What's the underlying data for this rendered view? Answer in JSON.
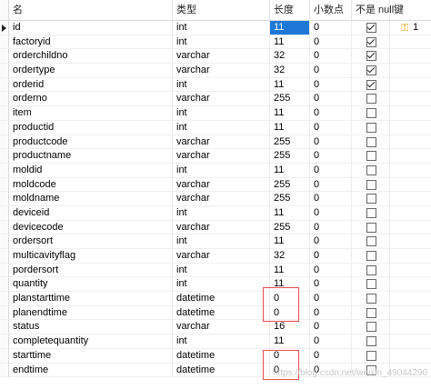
{
  "headers": {
    "name": "名",
    "type": "类型",
    "length": "长度",
    "decimals": "小数点",
    "not_null": "不是 null",
    "key": "键"
  },
  "rows": [
    {
      "name": "id",
      "type": "int",
      "length": "11",
      "decimals": "0",
      "not_null": true,
      "key": "1",
      "selected": true
    },
    {
      "name": "factoryid",
      "type": "int",
      "length": "11",
      "decimals": "0",
      "not_null": true,
      "key": ""
    },
    {
      "name": "orderchildno",
      "type": "varchar",
      "length": "32",
      "decimals": "0",
      "not_null": true,
      "key": ""
    },
    {
      "name": "ordertype",
      "type": "varchar",
      "length": "32",
      "decimals": "0",
      "not_null": true,
      "key": ""
    },
    {
      "name": "orderid",
      "type": "int",
      "length": "11",
      "decimals": "0",
      "not_null": true,
      "key": ""
    },
    {
      "name": "orderno",
      "type": "varchar",
      "length": "255",
      "decimals": "0",
      "not_null": false,
      "key": ""
    },
    {
      "name": "item",
      "type": "int",
      "length": "11",
      "decimals": "0",
      "not_null": false,
      "key": ""
    },
    {
      "name": "productid",
      "type": "int",
      "length": "11",
      "decimals": "0",
      "not_null": false,
      "key": ""
    },
    {
      "name": "productcode",
      "type": "varchar",
      "length": "255",
      "decimals": "0",
      "not_null": false,
      "key": ""
    },
    {
      "name": "productname",
      "type": "varchar",
      "length": "255",
      "decimals": "0",
      "not_null": false,
      "key": ""
    },
    {
      "name": "moldid",
      "type": "int",
      "length": "11",
      "decimals": "0",
      "not_null": false,
      "key": ""
    },
    {
      "name": "moldcode",
      "type": "varchar",
      "length": "255",
      "decimals": "0",
      "not_null": false,
      "key": ""
    },
    {
      "name": "moldname",
      "type": "varchar",
      "length": "255",
      "decimals": "0",
      "not_null": false,
      "key": ""
    },
    {
      "name": "deviceid",
      "type": "int",
      "length": "11",
      "decimals": "0",
      "not_null": false,
      "key": ""
    },
    {
      "name": "devicecode",
      "type": "varchar",
      "length": "255",
      "decimals": "0",
      "not_null": false,
      "key": ""
    },
    {
      "name": "ordersort",
      "type": "int",
      "length": "11",
      "decimals": "0",
      "not_null": false,
      "key": ""
    },
    {
      "name": "multicavityflag",
      "type": "varchar",
      "length": "32",
      "decimals": "0",
      "not_null": false,
      "key": ""
    },
    {
      "name": "pordersort",
      "type": "int",
      "length": "11",
      "decimals": "0",
      "not_null": false,
      "key": ""
    },
    {
      "name": "quantity",
      "type": "int",
      "length": "11",
      "decimals": "0",
      "not_null": false,
      "key": ""
    },
    {
      "name": "planstarttime",
      "type": "datetime",
      "length": "0",
      "decimals": "0",
      "not_null": false,
      "key": ""
    },
    {
      "name": "planendtime",
      "type": "datetime",
      "length": "0",
      "decimals": "0",
      "not_null": false,
      "key": ""
    },
    {
      "name": "status",
      "type": "varchar",
      "length": "16",
      "decimals": "0",
      "not_null": false,
      "key": ""
    },
    {
      "name": "completequantity",
      "type": "int",
      "length": "11",
      "decimals": "0",
      "not_null": false,
      "key": ""
    },
    {
      "name": "starttime",
      "type": "datetime",
      "length": "0",
      "decimals": "0",
      "not_null": false,
      "key": ""
    },
    {
      "name": "endtime",
      "type": "datetime",
      "length": "0",
      "decimals": "0",
      "not_null": false,
      "key": ""
    }
  ],
  "watermark": "https://blog.csdn.net/weixin_49044290"
}
